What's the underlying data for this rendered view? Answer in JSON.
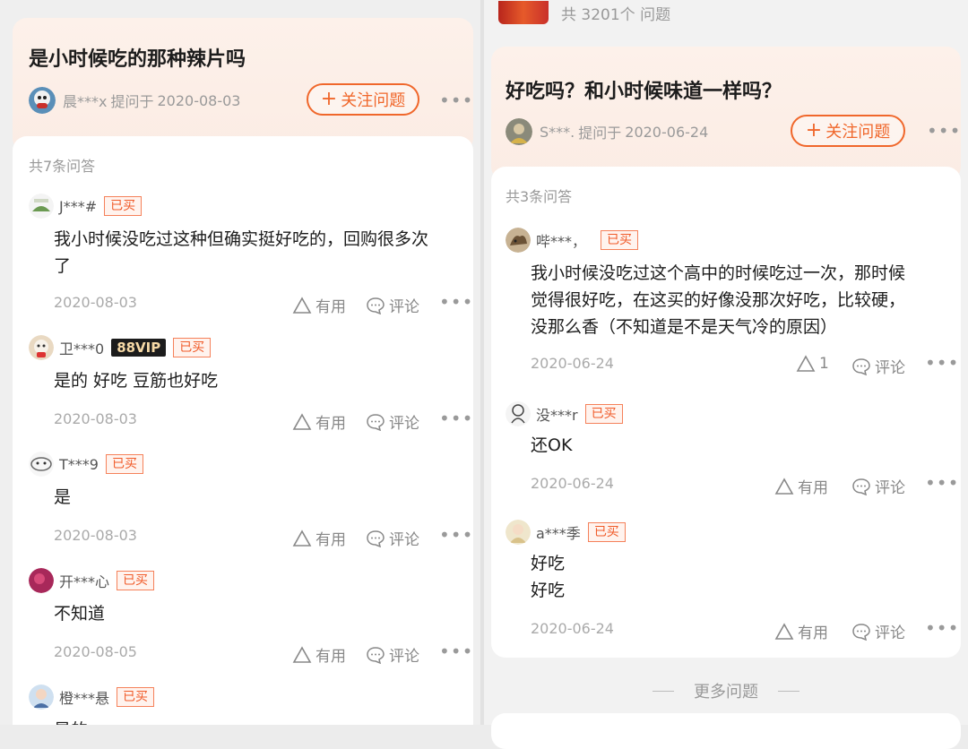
{
  "left": {
    "question": {
      "title": "是小时候吃的那种辣片吗",
      "asker": "晨***x",
      "asked_prefix": "提问于",
      "asked_date": "2020-08-03",
      "follow_label": "关注问题"
    },
    "answer_count": "共7条问答",
    "answers": [
      {
        "user": "J***#",
        "badge": "已买",
        "text1": "我小时候没吃过这种但确实挺好吃的，回购很多次",
        "text2": "了",
        "date": "2020-08-03",
        "useful": "有用",
        "comment": "评论"
      },
      {
        "user": "卫***0",
        "vip": "88VIP",
        "badge": "已买",
        "text1": "是的 好吃 豆筋也好吃",
        "date": "2020-08-03",
        "useful": "有用",
        "comment": "评论"
      },
      {
        "user": "T***9",
        "badge": "已买",
        "text1": "是",
        "date": "2020-08-03",
        "useful": "有用",
        "comment": "评论"
      },
      {
        "user": "开***心",
        "badge": "已买",
        "text1": "不知道",
        "date": "2020-08-05",
        "useful": "有用",
        "comment": "评论"
      },
      {
        "user": "橙***悬",
        "badge": "已买",
        "text1": "是的"
      }
    ]
  },
  "right": {
    "top_count": "共 3201个 问题",
    "question": {
      "title": "好吃吗？和小时候味道一样吗？",
      "asker": "S***.",
      "asked_prefix": "提问于",
      "asked_date": "2020-06-24",
      "follow_label": "关注问题"
    },
    "answer_count": "共3条问答",
    "answers": [
      {
        "user": "哔***，",
        "badge": "已买",
        "text1": "我小时候没吃过这个高中的时候吃过一次，那时候",
        "text2": "觉得很好吃，在这买的好像没那次好吃，比较硬，",
        "text3": "没那么香（不知道是不是天气冷的原因）",
        "date": "2020-06-24",
        "useful": "1",
        "comment": "评论"
      },
      {
        "user": "没***r",
        "badge": "已买",
        "text1": "还OK",
        "date": "2020-06-24",
        "useful": "有用",
        "comment": "评论"
      },
      {
        "user": "a***季",
        "badge": "已买",
        "text1": "好吃",
        "text2": "好吃",
        "date": "2020-06-24",
        "useful": "有用",
        "comment": "评论"
      }
    ],
    "more_questions": "更多问题"
  },
  "colors": {
    "accent": "#f0672b",
    "badge_text": "#f05a28",
    "card_tint": "#fdf1ea"
  },
  "icons": [
    "plus-icon",
    "more-icon",
    "thumb-up-triangle-icon",
    "comment-icon"
  ]
}
